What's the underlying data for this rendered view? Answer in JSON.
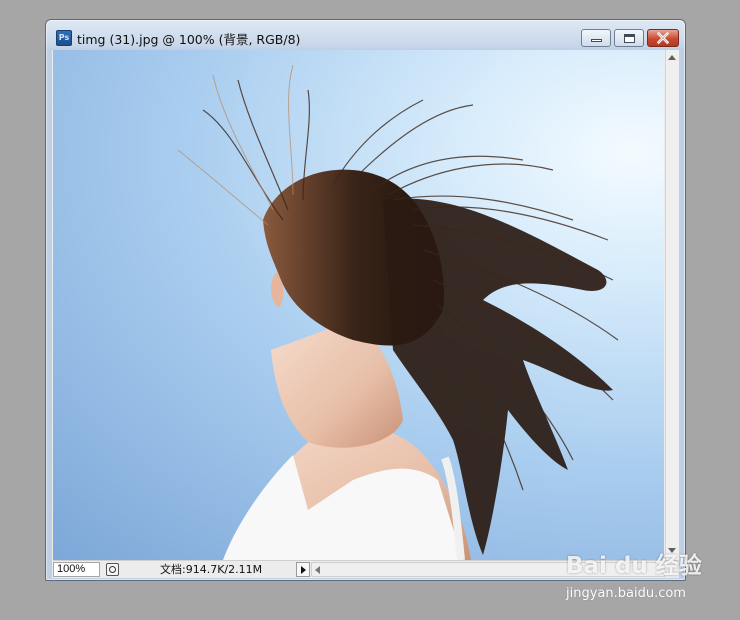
{
  "window": {
    "title": "timg (31).jpg @ 100% (背景, RGB/8)",
    "app_icon": "photoshop-document-icon",
    "app_icon_text": "Ps",
    "controls": [
      "minimize-icon",
      "maximize-icon",
      "close-icon"
    ],
    "accent_close": "#c94a31"
  },
  "canvas": {
    "image": "woman-with-flowing-hair-photo",
    "background_colors": [
      "#7da7d8",
      "#a9cdef",
      "#f4fbff"
    ]
  },
  "statusbar": {
    "zoom": "100%",
    "doc_info": "文档:914.7K/2.11M"
  },
  "watermark": {
    "logo_text": "Bai du 经验",
    "url": "jingyan.baidu.com"
  }
}
